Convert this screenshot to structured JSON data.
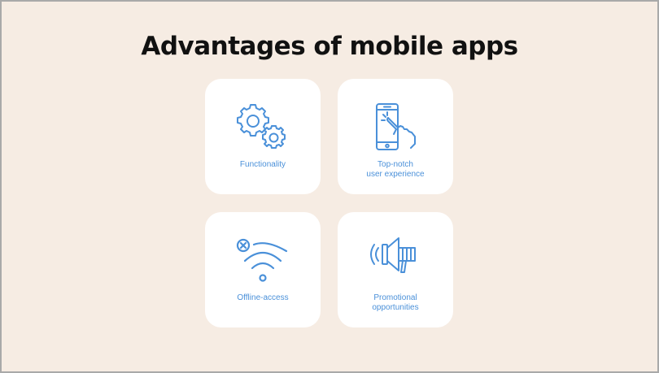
{
  "title": "Advantages of mobile apps",
  "colors": {
    "background": "#f6ece3",
    "card": "#ffffff",
    "accent": "#4a90d9",
    "title": "#111111"
  },
  "cards": [
    {
      "label": "Functionality",
      "icon": "gears-icon"
    },
    {
      "label": "Top-notch\nuser experience",
      "icon": "phone-touch-icon"
    },
    {
      "label": "Offline-access",
      "icon": "wifi-off-icon"
    },
    {
      "label": "Promotional\nopportunities",
      "icon": "megaphone-icon"
    }
  ]
}
